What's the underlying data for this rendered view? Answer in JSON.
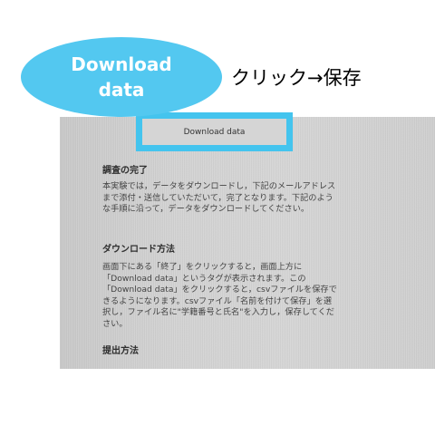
{
  "callout": {
    "line1": "Download",
    "line2": "data",
    "instruction": "クリック→保存"
  },
  "screen": {
    "download_button": "Download data",
    "section1_title": "調査の完了",
    "section1_body": "本実験では，データをダウンロードし，下記のメールアドレスまで添付・送信していただいて，完了となります。下記のような手順に沿って，データをダウンロードしてください。",
    "section2_title": "ダウンロード方法",
    "section2_body": "画面下にある「終了」をクリックすると，画面上方に「Download data」というタグが表示されます。この「Download data」をクリックすると，csvファイルを保存できるようになります。csvファイル「名前を付けて保存」を選択し，ファイル名に\"学籍番号と氏名\"を入力し，保存してください。",
    "section3_title": "提出方法"
  },
  "colors": {
    "accent": "#53c8f0",
    "highlight_border": "#44c4ee"
  }
}
